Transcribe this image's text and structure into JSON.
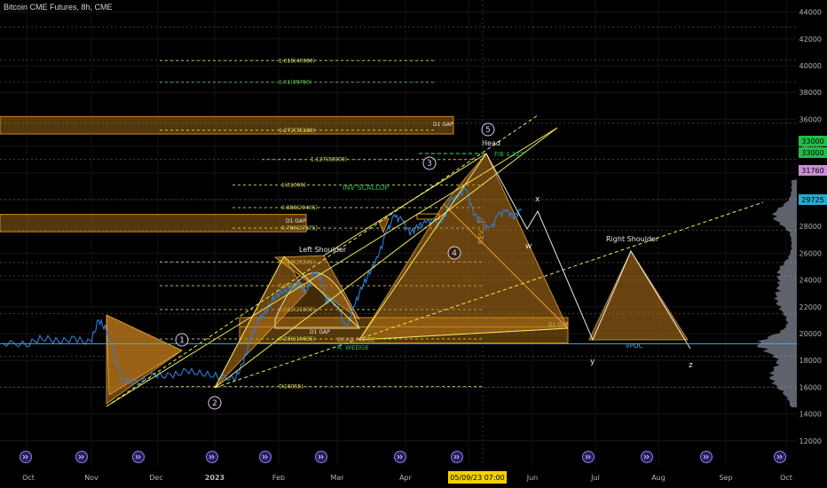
{
  "title": "Bitcoin CME Futures, 8h, CME",
  "chart_data": {
    "type": "line",
    "instrument": "Bitcoin CME Futures",
    "interval": "8h",
    "exchange": "CME",
    "ylim": [
      11000,
      44000
    ],
    "y_ticks": [
      12000,
      14000,
      16000,
      18000,
      20000,
      22000,
      24000,
      26000,
      28000,
      30000,
      32000,
      34000,
      36000,
      38000,
      40000,
      42000,
      44000
    ],
    "x_ticks": [
      "Oct",
      "Nov",
      "Dec",
      "2023",
      "Feb",
      "Mar",
      "Apr",
      "Jun",
      "Jul",
      "Aug",
      "Sep",
      "Oct"
    ],
    "crosshair_date": "05/09/23  07:00",
    "price_badges": [
      {
        "value": "33000",
        "color": "#1fbf4a"
      },
      {
        "value": "33000",
        "color": "#1fbf4a"
      },
      {
        "value": "31760",
        "color": "#c98fd6"
      },
      {
        "value": "29725",
        "color": "#2aa9c9"
      }
    ],
    "series": [
      {
        "name": "price",
        "points": [
          [
            -0.03,
            19300
          ],
          [
            0.0,
            19200
          ],
          [
            0.02,
            19700
          ],
          [
            0.04,
            19400
          ],
          [
            0.06,
            19600
          ],
          [
            0.08,
            19300
          ],
          [
            0.09,
            21000
          ],
          [
            0.1,
            20300
          ],
          [
            0.12,
            16500
          ],
          [
            0.14,
            16300
          ],
          [
            0.16,
            16900
          ],
          [
            0.18,
            16800
          ],
          [
            0.2,
            17200
          ],
          [
            0.22,
            17000
          ],
          [
            0.24,
            16800
          ],
          [
            0.26,
            16600
          ],
          [
            0.27,
            17600
          ],
          [
            0.28,
            19500
          ],
          [
            0.29,
            21000
          ],
          [
            0.3,
            21600
          ],
          [
            0.31,
            22700
          ],
          [
            0.32,
            23100
          ],
          [
            0.33,
            23300
          ],
          [
            0.34,
            23700
          ],
          [
            0.35,
            23000
          ],
          [
            0.36,
            24600
          ],
          [
            0.37,
            23900
          ],
          [
            0.375,
            22300
          ],
          [
            0.38,
            22600
          ],
          [
            0.39,
            22000
          ],
          [
            0.4,
            20300
          ],
          [
            0.41,
            22000
          ],
          [
            0.42,
            23500
          ],
          [
            0.43,
            24600
          ],
          [
            0.44,
            25700
          ],
          [
            0.45,
            27500
          ],
          [
            0.46,
            28700
          ],
          [
            0.47,
            28500
          ],
          [
            0.48,
            27500
          ],
          [
            0.49,
            28000
          ],
          [
            0.5,
            28300
          ],
          [
            0.51,
            28400
          ],
          [
            0.52,
            28100
          ],
          [
            0.53,
            29900
          ],
          [
            0.54,
            30200
          ],
          [
            0.55,
            30900
          ],
          [
            0.56,
            28900
          ],
          [
            0.57,
            28400
          ],
          [
            0.58,
            27700
          ],
          [
            0.59,
            28800
          ],
          [
            0.6,
            29200
          ],
          [
            0.61,
            28700
          ],
          [
            0.62,
            29300
          ]
        ]
      }
    ],
    "fib_levels": [
      {
        "ratio": "1.618",
        "value": 40380,
        "label": "1.618(40380)"
      },
      {
        "ratio": "1.51",
        "value": 38760,
        "label": "1.51(38760)"
      },
      {
        "ratio": "1.272",
        "value": 35180,
        "label": "1.272(35180)"
      },
      {
        "ratio": "1.127",
        "value": 33000,
        "label": "1.127(33000)"
      },
      {
        "ratio": "1",
        "value": 31090,
        "label": "1(31090)"
      },
      {
        "ratio": "0.888",
        "value": 29405,
        "label": "0.888(29405)"
      },
      {
        "ratio": "0.786",
        "value": 27875,
        "label": "0.786(27875)"
      },
      {
        "ratio": "0.618",
        "value": 25345,
        "label": "0.618(25345)"
      },
      {
        "ratio": "0.5",
        "value": 23575,
        "label": "0.5(23575)"
      },
      {
        "ratio": "0.382",
        "value": 21800,
        "label": "0.382(21800)"
      },
      {
        "ratio": "0.236",
        "value": 19605,
        "label": "0.236(19605)"
      },
      {
        "ratio": "0",
        "value": 16055,
        "label": "0(16055)"
      }
    ],
    "gap_zones": [
      {
        "label": "D1 GAP",
        "from": 34900,
        "to": 36200
      },
      {
        "label": "D1 GAP",
        "from": 27600,
        "to": 28900
      },
      {
        "label": "D1 GAP",
        "from": 20500,
        "to": 21200
      },
      {
        "label": "D1 GAP",
        "from": 19300,
        "to": 20500
      }
    ],
    "annotations": [
      "Head",
      "Left Shoulder",
      "Right Shoulder",
      "INV SCALLOP",
      "FIB 1.127",
      "REV...?",
      "BEAR.R.DGE",
      "R. WEDGE",
      "VPOC",
      "x",
      "w",
      "y",
      "z"
    ],
    "wave_labels": [
      "1",
      "2",
      "3",
      "4",
      "5"
    ]
  }
}
